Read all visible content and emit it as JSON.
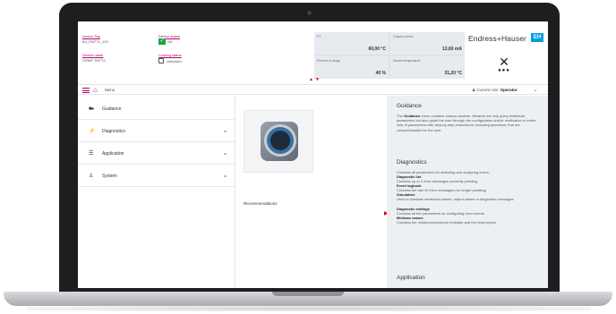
{
  "header": {
    "device_tag_label": "Device Tag",
    "device_tag_value": "B4_FMT72_124",
    "device_name_label": "Device name",
    "device_name_value": "iTEMP TMT72",
    "device_status_label": "Device status",
    "device_status_value": "OK",
    "locking_status_label": "Locking status",
    "locking_status_value": "Unlocked",
    "measurements": [
      {
        "label": "PV",
        "value": "60,00 °C"
      },
      {
        "label": "Output current",
        "value": "13,60 mA"
      },
      {
        "label": "Percent of range",
        "value": "40 %"
      },
      {
        "label": "Device temperature",
        "value": "31,20 °C"
      }
    ],
    "brand": "Endress+Hauser",
    "brand_badge": "EH",
    "status_ok_color": "#1ea446",
    "accent_color": "#b4006e"
  },
  "navbar": {
    "crumb": "Menu",
    "role_prefix": "Current role:",
    "role_value": "Operator"
  },
  "sidebar": {
    "items": [
      {
        "label": "Guidance",
        "icon": "guidance-icon",
        "has_chevron": false
      },
      {
        "label": "Diagnostics",
        "icon": "diagnostics-icon",
        "has_chevron": true
      },
      {
        "label": "Application",
        "icon": "application-icon",
        "has_chevron": true
      },
      {
        "label": "System",
        "icon": "system-icon",
        "has_chevron": true
      }
    ]
  },
  "center": {
    "recommendations_label": "Recommendations"
  },
  "panel": {
    "guidance_title": "Guidance",
    "guidance_text_prefix": "The",
    "guidance_text_bold": "Guidance",
    "guidance_text_rest": "menu contains various wizards. Wizards not only query individual parameters but also guide the user through the configuration and/or verification of entire sets of parameters with step-by-step instructions, including questions, that are comprehensible for the user.",
    "diagnostics_title": "Diagnostics",
    "diagnostics_intro": "Contains all parameters for detecting and analyzing errors:",
    "diagnostics_items": [
      {
        "title": "Diagnostic list",
        "desc": "Contains up to 3 error messages currently pending"
      },
      {
        "title": "Event logbook",
        "desc": "Contains the last 10 error messages (no longer pending)"
      },
      {
        "title": "Simulation",
        "desc": "Used to simulate measured values, output values or diagnostic messages"
      },
      {
        "title": "Diagnostic settings",
        "desc": "Contains all the parameters for configuring error events"
      },
      {
        "title": "Min/max values",
        "desc": "Contains the minimum/maximum indicator and the reset option"
      }
    ],
    "application_title": "Application"
  }
}
